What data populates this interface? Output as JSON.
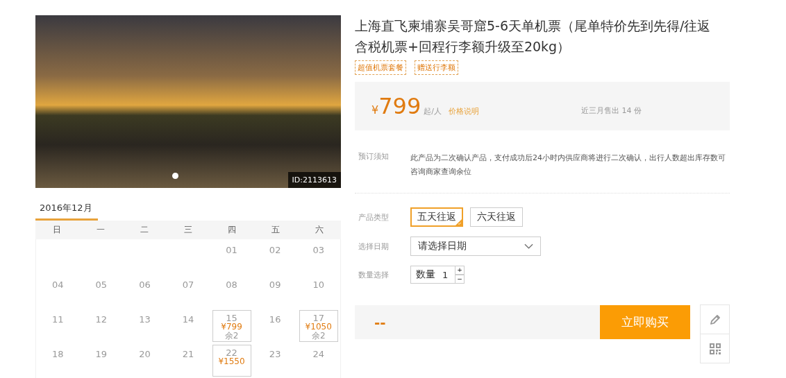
{
  "gallery": {
    "id_badge": "ID:2113613",
    "dots": [
      {
        "selected": true
      }
    ]
  },
  "calendar": {
    "month": "2016年12月",
    "weekdays": [
      "日",
      "一",
      "二",
      "三",
      "四",
      "五",
      "六"
    ],
    "weeks": [
      [
        {
          "kind": "empty"
        },
        {
          "kind": "empty"
        },
        {
          "kind": "empty"
        },
        {
          "kind": "empty"
        },
        {
          "kind": "day",
          "day": "01"
        },
        {
          "kind": "day",
          "day": "02"
        },
        {
          "kind": "day",
          "day": "03"
        }
      ],
      [
        {
          "kind": "day",
          "day": "04"
        },
        {
          "kind": "day",
          "day": "05"
        },
        {
          "kind": "day",
          "day": "06"
        },
        {
          "kind": "day",
          "day": "07"
        },
        {
          "kind": "day",
          "day": "08"
        },
        {
          "kind": "day",
          "day": "09"
        },
        {
          "kind": "day",
          "day": "10"
        }
      ],
      [
        {
          "kind": "day",
          "day": "11"
        },
        {
          "kind": "day",
          "day": "12"
        },
        {
          "kind": "day",
          "day": "13"
        },
        {
          "kind": "day",
          "day": "14"
        },
        {
          "kind": "available",
          "day": "15",
          "price": "¥799",
          "stock": "余2"
        },
        {
          "kind": "day",
          "day": "16"
        },
        {
          "kind": "available",
          "day": "17",
          "price": "¥1050",
          "stock": "余2"
        }
      ],
      [
        {
          "kind": "day",
          "day": "18"
        },
        {
          "kind": "day",
          "day": "19"
        },
        {
          "kind": "day",
          "day": "20"
        },
        {
          "kind": "day",
          "day": "21"
        },
        {
          "kind": "available",
          "day": "22",
          "price": "¥1550"
        },
        {
          "kind": "day",
          "day": "23"
        },
        {
          "kind": "day",
          "day": "24"
        }
      ]
    ]
  },
  "product": {
    "title": "上海直飞柬埔寨吴哥窟5-6天单机票（尾单特价先到先得/往返含税机票+回程行李额升级至20kg）",
    "tags": [
      "超值机票套餐",
      "赠送行李额"
    ],
    "price": {
      "currency": "¥",
      "amount": "799",
      "unit": "起/人",
      "note_link": "价格说明",
      "sold": "近三月售出 14 份"
    },
    "notice": {
      "label": "预订须知",
      "text": "此产品为二次确认产品，支付成功后24小时内供应商将进行二次确认，出行人数超出库存数可咨询商家查询余位"
    },
    "type": {
      "label": "产品类型",
      "options": [
        {
          "label": "五天往返",
          "selected": true
        },
        {
          "label": "六天往返",
          "selected": false
        }
      ]
    },
    "date": {
      "label": "选择日期",
      "placeholder": "请选择日期"
    },
    "quantity": {
      "label": "数量选择",
      "field_label": "数量",
      "value": "1",
      "increment": "+",
      "decrement": "−"
    },
    "total": "--",
    "buy_button": "立即购买"
  }
}
